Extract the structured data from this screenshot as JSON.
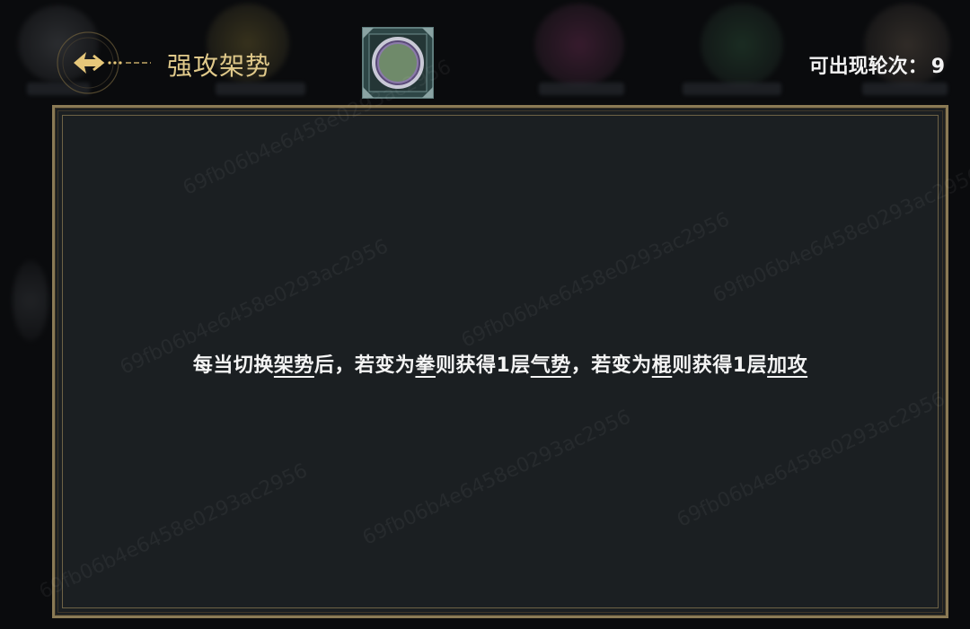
{
  "header": {
    "title": "强攻架势",
    "rounds_label": "可出现轮次：",
    "rounds_value": "9"
  },
  "description": {
    "segments": [
      {
        "text": "每当切换",
        "keyword": false
      },
      {
        "text": "架势",
        "keyword": true
      },
      {
        "text": "后，若变为",
        "keyword": false
      },
      {
        "text": "拳",
        "keyword": true
      },
      {
        "text": "则获得1层",
        "keyword": false
      },
      {
        "text": "气势",
        "keyword": true
      },
      {
        "text": "，若变为",
        "keyword": false
      },
      {
        "text": "棍",
        "keyword": true
      },
      {
        "text": "则获得1层",
        "keyword": false
      },
      {
        "text": "加攻",
        "keyword": true
      }
    ]
  },
  "watermark_text": "69fb06b4e6458e0293ac2956",
  "icons": {
    "back": "back-arrow-icon",
    "badge": "stance-badge-icon"
  },
  "colors": {
    "title_gold": "#e0c98a",
    "panel_border": "#8a7a55",
    "panel_bg": "#1b1f22",
    "badge_inner": "#6f8a6a"
  }
}
